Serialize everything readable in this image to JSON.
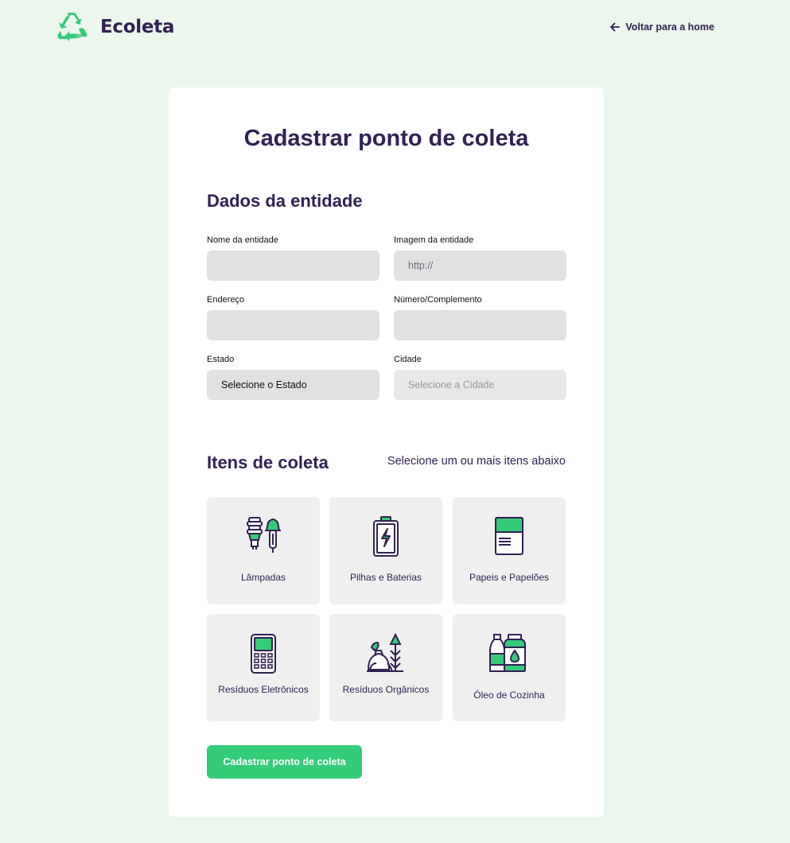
{
  "header": {
    "logo_text": "Ecoleta",
    "back_link": "Voltar para a home"
  },
  "form": {
    "title": "Cadastrar ponto de coleta",
    "entity_section": "Dados da entidade",
    "fields": {
      "name_label": "Nome da entidade",
      "name_value": "",
      "image_label": "Imagem da entidade",
      "image_placeholder": "http://",
      "address_label": "Endereço",
      "address_value": "",
      "number_label": "Número/Complemento",
      "number_value": "",
      "state_label": "Estado",
      "state_value": "Selecione o Estado",
      "city_label": "Cidade",
      "city_value": "Selecione a Cidade"
    },
    "items_section": "Itens de coleta",
    "items_hint": "Selecione um ou mais itens abaixo",
    "items": [
      {
        "label": "Lâmpadas",
        "icon": "lamp-icon"
      },
      {
        "label": "Pilhas e Baterias",
        "icon": "battery-icon"
      },
      {
        "label": "Papeis e Papelões",
        "icon": "paper-icon"
      },
      {
        "label": "Resíduos Eletrônicos",
        "icon": "electronics-icon"
      },
      {
        "label": "Resíduos Orgânicos",
        "icon": "organic-icon"
      },
      {
        "label": "Óleo de Cozinha",
        "icon": "oil-icon"
      }
    ],
    "submit_label": "Cadastrar ponto de coleta"
  },
  "colors": {
    "background": "#ebf6ec",
    "primary": "#34cb79",
    "title": "#322153",
    "field": "#e1e1e1",
    "item": "#efefef"
  }
}
